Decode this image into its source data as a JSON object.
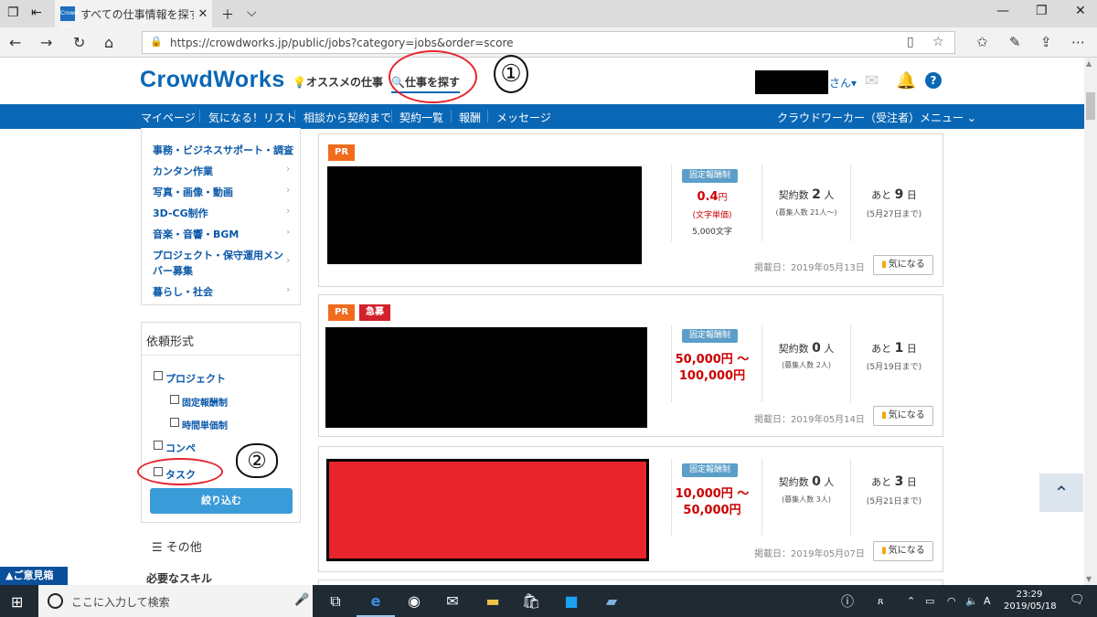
{
  "browser": {
    "tab_title": "すべての仕事情報を探す(1",
    "tab_favicon_text": "Crowd Works",
    "url": "https://crowdworks.jp/public/jobs?category=jobs&order=score"
  },
  "header": {
    "logo": "CrowdWorks",
    "nav_recommend": "オススメの仕事",
    "nav_find": "仕事を探す",
    "annotation_1": "①",
    "user_suffix": "さん▾"
  },
  "bluenav": {
    "items": [
      "マイページ",
      "気になる！リスト",
      "相談から契約まで",
      "契約一覧",
      "報酬",
      "メッセージ"
    ],
    "menu": "クラウドワーカー（受注者）メニュー"
  },
  "sidebar": {
    "categories": [
      "事務・ビジネスサポート・調査",
      "カンタン作業",
      "写真・画像・動画",
      "3D-CG制作",
      "音楽・音響・BGM",
      "プロジェクト・保守運用メン",
      "バー募集",
      "暮らし・社会"
    ],
    "filter_title": "依頼形式",
    "options": {
      "project": "プロジェクト",
      "fixed": "固定報酬制",
      "hourly": "時間単価制",
      "compe": "コンペ",
      "task": "タスク"
    },
    "annotation_2": "②",
    "filter_button": "絞り込む",
    "other": "その他",
    "skills": "必要なスキル"
  },
  "feedback": "▲ご意見箱",
  "jobs": [
    {
      "badges": [
        "PR"
      ],
      "pay_type": "固定報酬制",
      "price_num": "0.4",
      "price_unit": "円",
      "price_note": "(文字単価)",
      "chars": "5,000文字",
      "contracts_label": "契約数",
      "contracts_num": "2",
      "contracts_unit": "人",
      "recruit": "(募集人数 21人～)",
      "remain_label": "あと",
      "remain_num": "9",
      "remain_unit": "日",
      "deadline": "(5月27日まで)",
      "posted": "掲載日：2019年05月13日",
      "fav": "気になる"
    },
    {
      "badges": [
        "PR",
        "急募"
      ],
      "pay_type": "固定報酬制",
      "price_line1": "50,000円 ～",
      "price_line2": "100,000円",
      "contracts_label": "契約数",
      "contracts_num": "0",
      "contracts_unit": "人",
      "recruit": "(募集人数 2人)",
      "remain_label": "あと",
      "remain_num": "1",
      "remain_unit": "日",
      "deadline": "(5月19日まで)",
      "posted": "掲載日：2019年05月14日",
      "fav": "気になる"
    },
    {
      "badges": [],
      "pay_type": "固定報酬制",
      "price_line1": "10,000円 ～",
      "price_line2": "50,000円",
      "contracts_label": "契約数",
      "contracts_num": "0",
      "contracts_unit": "人",
      "recruit": "(募集人数 3人)",
      "remain_label": "あと",
      "remain_num": "3",
      "remain_unit": "日",
      "deadline": "(5月21日まで)",
      "posted": "掲載日：2019年05月07日",
      "fav": "気になる"
    }
  ],
  "taskbar": {
    "search_placeholder": "ここに入力して検索",
    "time": "23:29",
    "date": "2019/05/18"
  },
  "colors": {
    "brand_blue": "#0a67b5",
    "annotation_red": "#e8242d",
    "price_red": "#cc0000",
    "pr_orange": "#f26b1d"
  }
}
